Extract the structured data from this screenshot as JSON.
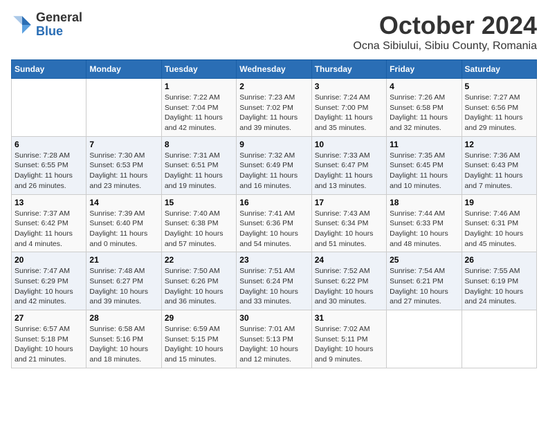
{
  "header": {
    "logo_line1": "General",
    "logo_line2": "Blue",
    "month": "October 2024",
    "location": "Ocna Sibiului, Sibiu County, Romania"
  },
  "weekdays": [
    "Sunday",
    "Monday",
    "Tuesday",
    "Wednesday",
    "Thursday",
    "Friday",
    "Saturday"
  ],
  "weeks": [
    [
      {
        "day": "",
        "detail": ""
      },
      {
        "day": "",
        "detail": ""
      },
      {
        "day": "1",
        "detail": "Sunrise: 7:22 AM\nSunset: 7:04 PM\nDaylight: 11 hours and 42 minutes."
      },
      {
        "day": "2",
        "detail": "Sunrise: 7:23 AM\nSunset: 7:02 PM\nDaylight: 11 hours and 39 minutes."
      },
      {
        "day": "3",
        "detail": "Sunrise: 7:24 AM\nSunset: 7:00 PM\nDaylight: 11 hours and 35 minutes."
      },
      {
        "day": "4",
        "detail": "Sunrise: 7:26 AM\nSunset: 6:58 PM\nDaylight: 11 hours and 32 minutes."
      },
      {
        "day": "5",
        "detail": "Sunrise: 7:27 AM\nSunset: 6:56 PM\nDaylight: 11 hours and 29 minutes."
      }
    ],
    [
      {
        "day": "6",
        "detail": "Sunrise: 7:28 AM\nSunset: 6:55 PM\nDaylight: 11 hours and 26 minutes."
      },
      {
        "day": "7",
        "detail": "Sunrise: 7:30 AM\nSunset: 6:53 PM\nDaylight: 11 hours and 23 minutes."
      },
      {
        "day": "8",
        "detail": "Sunrise: 7:31 AM\nSunset: 6:51 PM\nDaylight: 11 hours and 19 minutes."
      },
      {
        "day": "9",
        "detail": "Sunrise: 7:32 AM\nSunset: 6:49 PM\nDaylight: 11 hours and 16 minutes."
      },
      {
        "day": "10",
        "detail": "Sunrise: 7:33 AM\nSunset: 6:47 PM\nDaylight: 11 hours and 13 minutes."
      },
      {
        "day": "11",
        "detail": "Sunrise: 7:35 AM\nSunset: 6:45 PM\nDaylight: 11 hours and 10 minutes."
      },
      {
        "day": "12",
        "detail": "Sunrise: 7:36 AM\nSunset: 6:43 PM\nDaylight: 11 hours and 7 minutes."
      }
    ],
    [
      {
        "day": "13",
        "detail": "Sunrise: 7:37 AM\nSunset: 6:42 PM\nDaylight: 11 hours and 4 minutes."
      },
      {
        "day": "14",
        "detail": "Sunrise: 7:39 AM\nSunset: 6:40 PM\nDaylight: 11 hours and 0 minutes."
      },
      {
        "day": "15",
        "detail": "Sunrise: 7:40 AM\nSunset: 6:38 PM\nDaylight: 10 hours and 57 minutes."
      },
      {
        "day": "16",
        "detail": "Sunrise: 7:41 AM\nSunset: 6:36 PM\nDaylight: 10 hours and 54 minutes."
      },
      {
        "day": "17",
        "detail": "Sunrise: 7:43 AM\nSunset: 6:34 PM\nDaylight: 10 hours and 51 minutes."
      },
      {
        "day": "18",
        "detail": "Sunrise: 7:44 AM\nSunset: 6:33 PM\nDaylight: 10 hours and 48 minutes."
      },
      {
        "day": "19",
        "detail": "Sunrise: 7:46 AM\nSunset: 6:31 PM\nDaylight: 10 hours and 45 minutes."
      }
    ],
    [
      {
        "day": "20",
        "detail": "Sunrise: 7:47 AM\nSunset: 6:29 PM\nDaylight: 10 hours and 42 minutes."
      },
      {
        "day": "21",
        "detail": "Sunrise: 7:48 AM\nSunset: 6:27 PM\nDaylight: 10 hours and 39 minutes."
      },
      {
        "day": "22",
        "detail": "Sunrise: 7:50 AM\nSunset: 6:26 PM\nDaylight: 10 hours and 36 minutes."
      },
      {
        "day": "23",
        "detail": "Sunrise: 7:51 AM\nSunset: 6:24 PM\nDaylight: 10 hours and 33 minutes."
      },
      {
        "day": "24",
        "detail": "Sunrise: 7:52 AM\nSunset: 6:22 PM\nDaylight: 10 hours and 30 minutes."
      },
      {
        "day": "25",
        "detail": "Sunrise: 7:54 AM\nSunset: 6:21 PM\nDaylight: 10 hours and 27 minutes."
      },
      {
        "day": "26",
        "detail": "Sunrise: 7:55 AM\nSunset: 6:19 PM\nDaylight: 10 hours and 24 minutes."
      }
    ],
    [
      {
        "day": "27",
        "detail": "Sunrise: 6:57 AM\nSunset: 5:18 PM\nDaylight: 10 hours and 21 minutes."
      },
      {
        "day": "28",
        "detail": "Sunrise: 6:58 AM\nSunset: 5:16 PM\nDaylight: 10 hours and 18 minutes."
      },
      {
        "day": "29",
        "detail": "Sunrise: 6:59 AM\nSunset: 5:15 PM\nDaylight: 10 hours and 15 minutes."
      },
      {
        "day": "30",
        "detail": "Sunrise: 7:01 AM\nSunset: 5:13 PM\nDaylight: 10 hours and 12 minutes."
      },
      {
        "day": "31",
        "detail": "Sunrise: 7:02 AM\nSunset: 5:11 PM\nDaylight: 10 hours and 9 minutes."
      },
      {
        "day": "",
        "detail": ""
      },
      {
        "day": "",
        "detail": ""
      }
    ]
  ]
}
